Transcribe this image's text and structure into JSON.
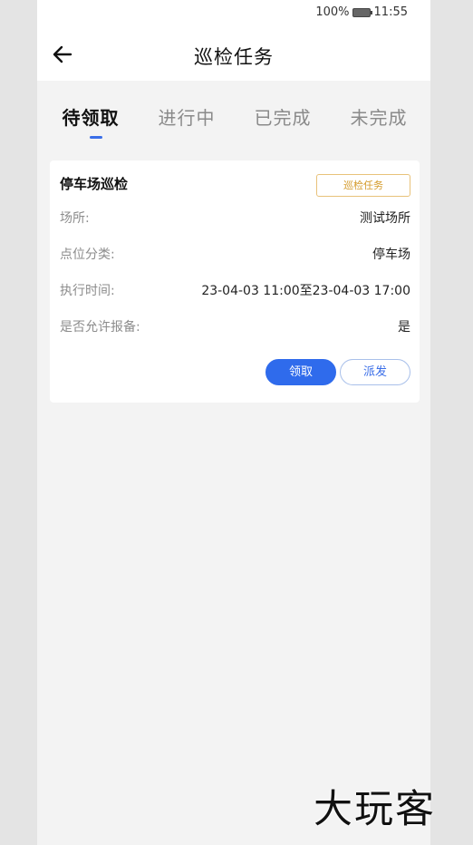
{
  "status_bar": {
    "battery_percent": "100%",
    "time": "11:55"
  },
  "header": {
    "title": "巡检任务",
    "back_icon": "arrow-left-icon"
  },
  "tabs": [
    {
      "label": "待领取",
      "active": true
    },
    {
      "label": "进行中",
      "active": false
    },
    {
      "label": "已完成",
      "active": false
    },
    {
      "label": "未完成",
      "active": false
    }
  ],
  "task_card": {
    "title": "停车场巡检",
    "badge": "巡检任务",
    "fields": [
      {
        "label": "场所:",
        "value": "测试场所"
      },
      {
        "label": "点位分类:",
        "value": "停车场"
      },
      {
        "label": "执行时间:",
        "value": "23-04-03 11:00至23-04-03 17:00"
      },
      {
        "label": "是否允许报备:",
        "value": "是"
      }
    ],
    "actions": {
      "claim_label": "领取",
      "dispatch_label": "派发"
    }
  },
  "watermark": "大玩客",
  "colors": {
    "accent": "#2f6bec",
    "badge": "#d49a2a",
    "page_bg": "#f3f3f3"
  }
}
